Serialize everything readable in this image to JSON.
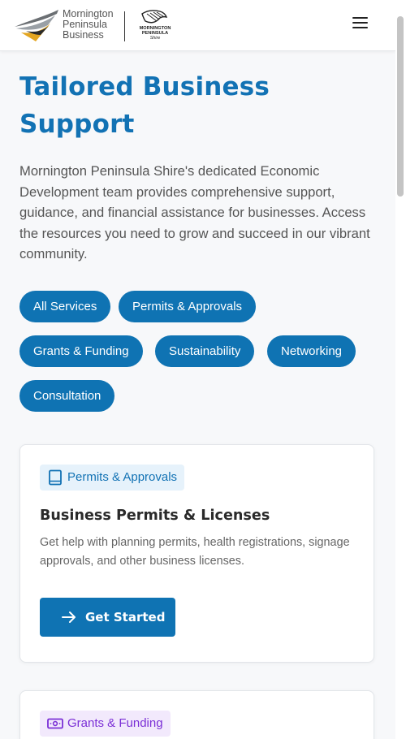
{
  "header": {
    "brand_lines": [
      "Mornington",
      "Peninsula",
      "Business"
    ],
    "shire_lines": [
      "MORNINGTON",
      "PENINSULA",
      "Shire"
    ],
    "menu_icon": "hamburger-menu-icon"
  },
  "hero": {
    "title_line1": "Tailored Business",
    "title_line2": "Support",
    "intro": "Mornington Peninsula Shire's dedicated Economic Development team provides comprehensive support, guidance, and financial assistance for businesses. Access the resources you need to grow and succeed in our vibrant community."
  },
  "filters": [
    "All Services",
    "Permits & Approvals",
    "Grants & Funding",
    "Sustainability",
    "Networking",
    "Consultation"
  ],
  "cards": [
    {
      "badge": "Permits & Approvals",
      "badge_icon": "book-icon",
      "badge_color": "#1272b4",
      "badge_bg": "#e6f2fb",
      "title": "Business Permits & Licenses",
      "description": "Get help with planning permits, health registrations, signage approvals, and other business licenses.",
      "cta_label": "Get Started",
      "cta_icon": "arrow-right-icon"
    },
    {
      "badge": "Grants & Funding",
      "badge_icon": "money-icon",
      "badge_color": "#7b2fd6",
      "badge_bg": "#f2e9fc"
    }
  ],
  "colors": {
    "primary": "#0f73b3",
    "title": "#1272b4"
  }
}
